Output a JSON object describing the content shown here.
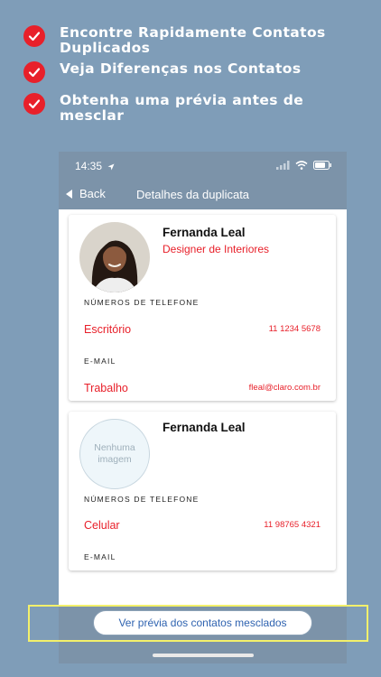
{
  "features": [
    {
      "text": "Encontre Rapidamente Contatos Duplicados"
    },
    {
      "text": "Veja Diferenças nos Contatos"
    },
    {
      "text": "Obtenha uma prévia antes de mesclar"
    }
  ],
  "status_bar": {
    "time": "14:35"
  },
  "nav": {
    "back_label": "Back",
    "title": "Detalhes da duplicata"
  },
  "cards": [
    {
      "name": "Fernanda Leal",
      "job_title": "Designer de Interiores",
      "phone_section": "NÚMEROS DE TELEFONE",
      "phone_label": "Escritório",
      "phone_value": "11 1234 5678",
      "email_section": "E-MAIL",
      "email_label": "Trabalho",
      "email_value": "fleal@claro.com.br"
    },
    {
      "name": "Fernanda Leal",
      "no_image_line1": "Nenhuma",
      "no_image_line2": "imagem",
      "phone_section": "NÚMEROS DE TELEFONE",
      "phone_label": "Celular",
      "phone_value": "11 98765 4321",
      "email_section": "E-MAIL"
    }
  ],
  "preview_button": {
    "label": "Ver prévia dos contatos mesclados"
  },
  "colors": {
    "accent_red": "#e8202a",
    "background": "#7f9db8",
    "bar": "#7c93a9",
    "link_blue": "#2f63b0"
  },
  "icons": [
    "checkmark-icon",
    "location-arrow-icon",
    "signal-icon",
    "wifi-icon",
    "battery-icon",
    "back-chevron-icon"
  ]
}
